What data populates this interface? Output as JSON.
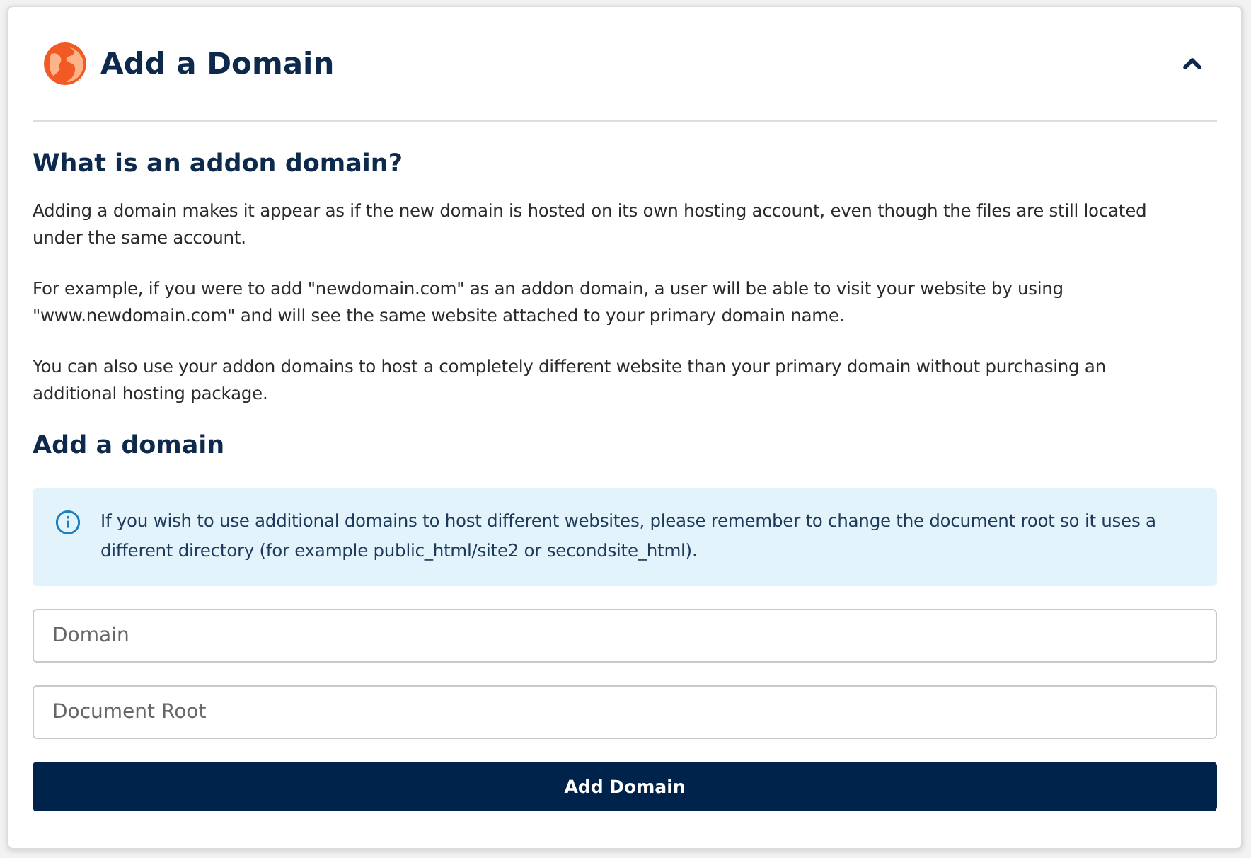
{
  "header": {
    "title": "Add a Domain",
    "expanded": true
  },
  "intro": {
    "heading": "What is an addon domain?",
    "paragraphs": [
      "Adding a domain makes it appear as if the new domain is hosted on its own hosting account, even though the files are still located under the same account.",
      "For example, if you were to add \"newdomain.com\" as an addon domain, a user will be able to visit your website by using \"www.newdomain.com\" and will see the same website attached to your primary domain name.",
      "You can also use your addon domains to host a completely different website than your primary domain without purchasing an additional hosting package."
    ]
  },
  "form": {
    "heading": "Add a domain",
    "notice": "If you wish to use additional domains to host different websites, please remember to change the document root so it uses a different directory (for example public_html/site2 or secondsite_html).",
    "fields": [
      {
        "placeholder": "Domain"
      },
      {
        "placeholder": "Document Root"
      }
    ],
    "submit": "Add Domain"
  }
}
